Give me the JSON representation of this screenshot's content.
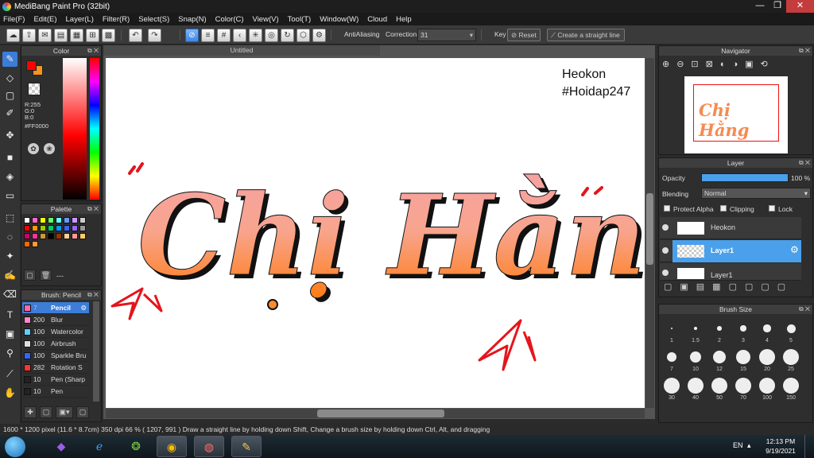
{
  "window": {
    "title": "MediBang Paint Pro (32bit)",
    "minimize": "—",
    "restore": "❐",
    "close": "✕"
  },
  "menu": [
    "File(F)",
    "Edit(E)",
    "Layer(L)",
    "Filter(R)",
    "Select(S)",
    "Snap(N)",
    "Color(C)",
    "View(V)",
    "Tool(T)",
    "Window(W)",
    "Cloud",
    "Help"
  ],
  "toolbar": {
    "antialiasing": "AntiAliasing",
    "correction_label": "Correction",
    "correction_value": "31",
    "key_label": "Key",
    "reset": "Reset",
    "straight_line": "Create a straight line"
  },
  "color_panel": {
    "title": "Color",
    "r": "R:255",
    "g": "G:0",
    "b": "B:0",
    "hex": "#FF0000",
    "fg": "#ff0000",
    "bg": "#f7931e"
  },
  "palette_panel": {
    "title": "Palette",
    "more": "---",
    "swatches": [
      "#ffffff",
      "#ff66cc",
      "#ffff00",
      "#66ff66",
      "#66ffff",
      "#6699ff",
      "#cc99ff",
      "#cccccc",
      "#ff0000",
      "#ff9900",
      "#99cc00",
      "#00cc66",
      "#0099ff",
      "#3366ff",
      "#9966ff",
      "#999999",
      "#cc0066",
      "#ff3399",
      "#cc9933",
      "#000000",
      "#993300",
      "#ffcc99",
      "#ff9999",
      "#ffcc66",
      "#ff6600",
      "#ff9933"
    ]
  },
  "brush_panel": {
    "title": "Brush: Pencil",
    "items": [
      {
        "size": "7",
        "name": "Pencil",
        "color": "#ff66aa",
        "selected": true
      },
      {
        "size": "200",
        "name": "Blur",
        "color": "#ff88cc"
      },
      {
        "size": "100",
        "name": "Watercolor",
        "color": "#66ccff"
      },
      {
        "size": "100",
        "name": "Airbrush",
        "color": "#dddddd"
      },
      {
        "size": "100",
        "name": "Sparkle Bru",
        "color": "#3366ff"
      },
      {
        "size": "282",
        "name": "Rotation S",
        "color": "#ff3333"
      },
      {
        "size": "10",
        "name": "Pen (Sharp",
        "color": "#222222"
      },
      {
        "size": "10",
        "name": "Pen",
        "color": "#222222"
      }
    ]
  },
  "document": {
    "tab": "Untitled",
    "watermark_line1": "Heokon",
    "watermark_line2": "#Hoidap247",
    "artwork_text": "Chị Hằng"
  },
  "navigator": {
    "title": "Navigator"
  },
  "layer_panel": {
    "title": "Layer",
    "opacity_label": "Opacity",
    "opacity_value": "100 %",
    "opacity": 1.0,
    "blending_label": "Blending",
    "blending_value": "Normal",
    "protect_alpha": "Protect Alpha",
    "clipping": "Clipping",
    "lock": "Lock",
    "layers": [
      {
        "name": "Heokon",
        "selected": false
      },
      {
        "name": "Layer1",
        "selected": true
      },
      {
        "name": "Layer1",
        "selected": false
      }
    ]
  },
  "brush_size_panel": {
    "title": "Brush Size",
    "sizes": [
      "1",
      "1.5",
      "2",
      "3",
      "4",
      "5",
      "7",
      "10",
      "12",
      "15",
      "20",
      "25",
      "30",
      "40",
      "50",
      "70",
      "100",
      "150"
    ]
  },
  "status": {
    "text": "1600 * 1200 pixel   (11.6 * 8.7cm)   350 dpi   66 %   ( 1207, 991 )   Draw a straight line by holding down Shift, Change a brush size by holding down Ctrl, Alt, and dragging"
  },
  "taskbar": {
    "lang": "EN",
    "time": "12:13 PM",
    "date": "9/19/2021"
  },
  "colors": {
    "accent": "#3c7dd8",
    "text_gradient_top": "#f6a1a1",
    "text_gradient_bottom": "#ff7a10"
  }
}
